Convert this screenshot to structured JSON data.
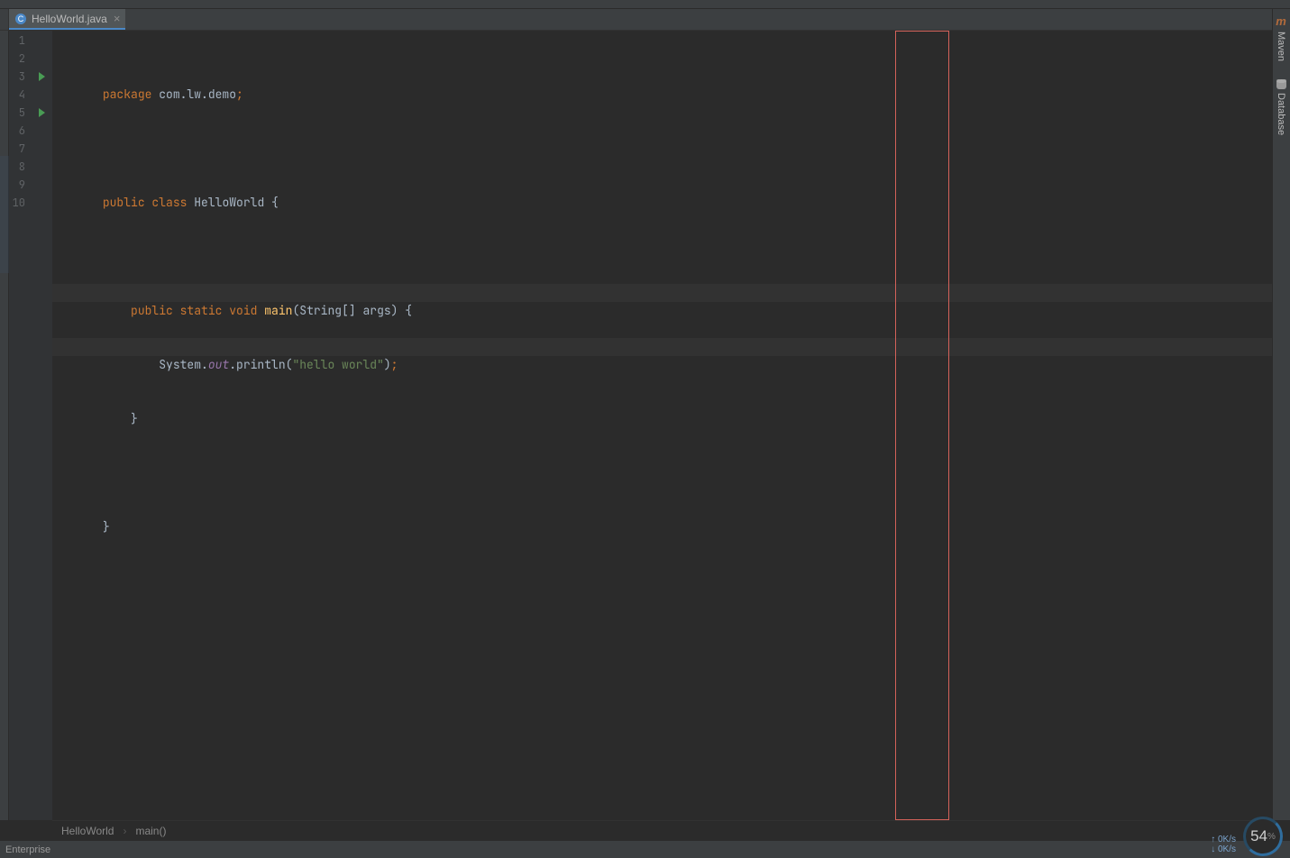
{
  "tab": {
    "filename": "HelloWorld.java",
    "close_glyph": "×"
  },
  "gutter": {
    "line_numbers": [
      "1",
      "2",
      "3",
      "4",
      "5",
      "6",
      "7",
      "8",
      "9",
      "10"
    ],
    "run_markers_at": [
      3,
      5
    ],
    "fold_open_at": [
      3,
      5
    ],
    "fold_close_at": [
      7
    ]
  },
  "code": {
    "l1": {
      "kw_package": "package",
      "pkg": " com.lw.demo",
      "semi": ";"
    },
    "l3": {
      "kw_public": "public",
      "kw_class": " class",
      "name": " HelloWorld",
      "brace": " {"
    },
    "l5": {
      "indent": "    ",
      "kw_public": "public",
      "kw_static": " static",
      "kw_void": " void",
      "m": " main",
      "args": "(String[] args)",
      "brace": " {"
    },
    "l6": {
      "indent": "        ",
      "sys": "System.",
      "out": "out",
      "print": ".println(",
      "str": "\"hello world\"",
      "close": ")",
      "semi": ";"
    },
    "l7": {
      "indent": "    ",
      "brace": "}"
    },
    "l9": {
      "brace": "}"
    }
  },
  "breadcrumb": {
    "class": "HelloWorld",
    "method": "main()"
  },
  "sidebar": {
    "maven": "Maven",
    "database": "Database"
  },
  "status": {
    "left": "Enterprise"
  },
  "net": {
    "up": "↑ 0K/s",
    "down": "↓ 0K/s"
  },
  "perf": {
    "value": "54",
    "unit": "%"
  },
  "inspection_ok": "✓"
}
